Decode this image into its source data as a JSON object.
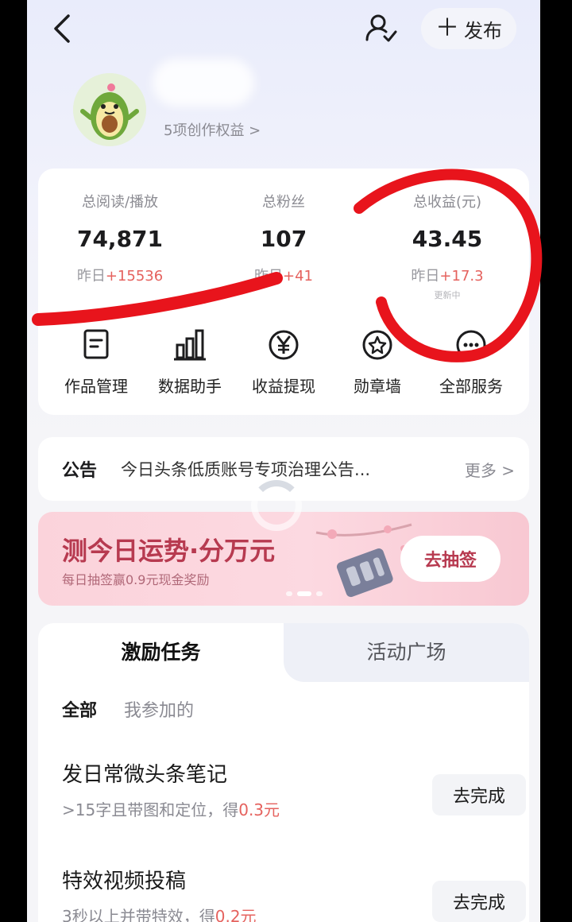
{
  "header": {
    "publish_label": "发布",
    "rights_text": "5项创作权益 >"
  },
  "stats": [
    {
      "label": "总阅读/播放",
      "value": "74,871",
      "delta_prefix": "昨日",
      "delta_value": "+15536",
      "note": ""
    },
    {
      "label": "总粉丝",
      "value": "107",
      "delta_prefix": "昨日",
      "delta_value": "+41",
      "note": ""
    },
    {
      "label": "总收益(元)",
      "value": "43.45",
      "delta_prefix": "昨日",
      "delta_value": "+17.3",
      "note": "更新中"
    }
  ],
  "services": [
    {
      "label": "作品管理",
      "icon": "document-icon"
    },
    {
      "label": "数据助手",
      "icon": "bar-chart-icon"
    },
    {
      "label": "收益提现",
      "icon": "yen-coin-icon"
    },
    {
      "label": "勋章墙",
      "icon": "medal-icon"
    },
    {
      "label": "全部服务",
      "icon": "more-services-icon"
    }
  ],
  "notice": {
    "tag": "公告",
    "message": "今日头条低质账号专项治理公告...",
    "more": "更多 >"
  },
  "banner": {
    "title": "测今日运势·分万元",
    "subtitle": "每日抽签赢0.9元现金奖励",
    "button": "去抽签"
  },
  "tasks_section": {
    "tabs": [
      "激励任务",
      "活动广场"
    ],
    "filters": [
      "全部",
      "我参加的"
    ],
    "items": [
      {
        "title": "发日常微头条笔记",
        "desc_prefix": ">15字且带图和定位，得",
        "amount": "0.3元",
        "button": "去完成"
      },
      {
        "title": "特效视频投稿",
        "desc_prefix": "3秒以上并带特效，得",
        "amount": "0.2元",
        "button": "去完成"
      }
    ]
  },
  "colors": {
    "accent_red": "#e5625e",
    "banner_pink": "#fbd3db",
    "annotation_red": "#e8141c"
  }
}
